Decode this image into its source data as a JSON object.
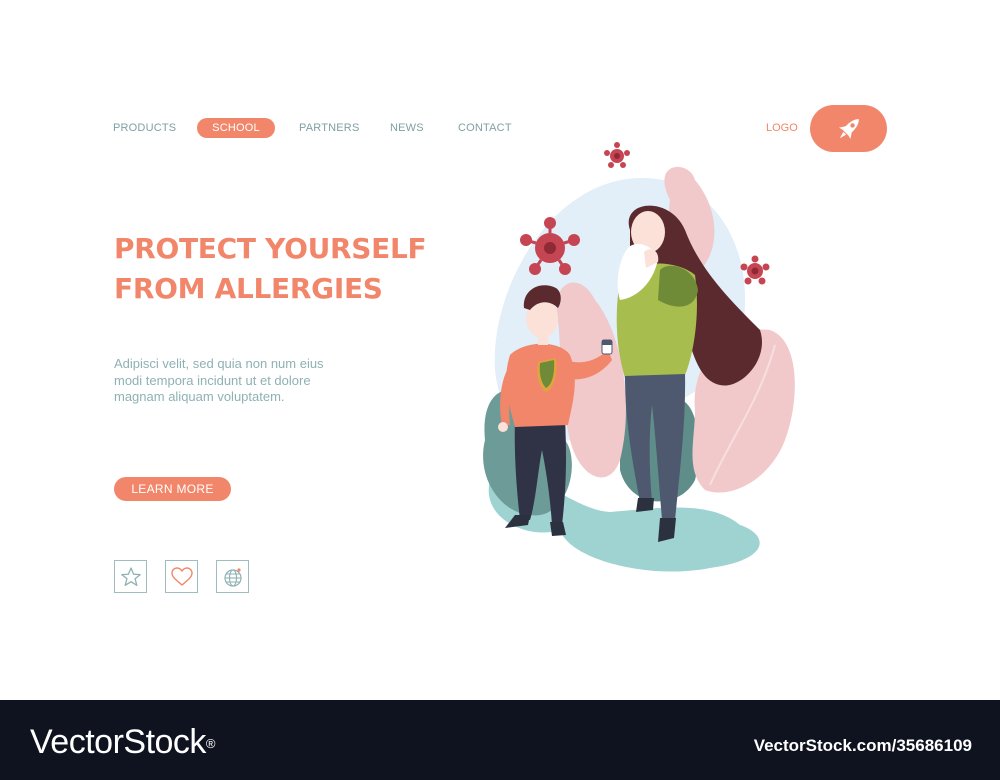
{
  "nav": {
    "items": [
      "PRODUCTS",
      "SCHOOL",
      "PARTNERS",
      "NEWS",
      "CONTACT"
    ],
    "active": "SCHOOL",
    "logo_label": "LOGO"
  },
  "hero": {
    "headline_line1": "PROTECT YOURSELF",
    "headline_line2": "FROM ALLERGIES",
    "body": "Adipisci velit, sed quia non num eius modi tempora incidunt ut et dolore magnam aliquam voluptatem.",
    "cta_label": "LEARN MORE"
  },
  "icons": [
    "star-icon",
    "heart-icon",
    "globe-icon",
    "rocket-icon"
  ],
  "colors": {
    "accent": "#f2866a",
    "nav_text": "#7fa0a3",
    "body_text": "#8fb1b4",
    "footer_bg": "#0f1320"
  },
  "footer": {
    "brand": "VectorStock",
    "brand_mark": "®",
    "image_id": "VectorStock.com/35686109"
  }
}
